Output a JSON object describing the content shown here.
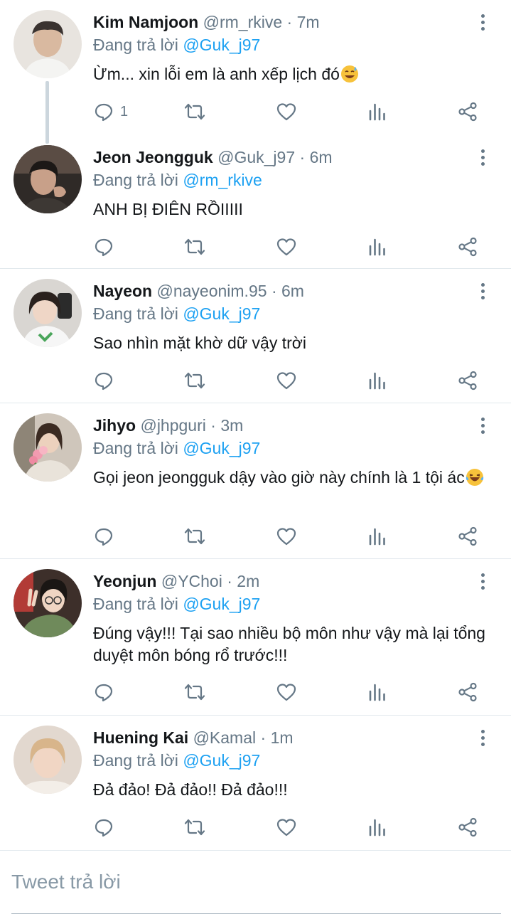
{
  "reply_prefix": "Đang trả lời",
  "tweets": [
    {
      "name": "Kim Namjoon",
      "handle": "@rm_rkive",
      "dot": "·",
      "time": "7m",
      "reply_to": "@Guk_j97",
      "text": "Ừm... xin lỗi em là anh xếp lịch đó",
      "emoji": "sweat-smile-emoji",
      "reply_count": "1",
      "avatar": "avatar-kim-namjoon"
    },
    {
      "name": "Jeon Jeongguk",
      "handle": "@Guk_j97",
      "dot": "·",
      "time": "6m",
      "reply_to": "@rm_rkive",
      "text": "ANH BỊ ĐIÊN RỒIIIII",
      "reply_count": "",
      "avatar": "avatar-jeon-jeongguk"
    },
    {
      "name": "Nayeon",
      "handle": "@nayeonim.95",
      "dot": "·",
      "time": "6m",
      "reply_to": "@Guk_j97",
      "text": "Sao nhìn mặt khờ dữ vậy trời",
      "reply_count": "",
      "avatar": "avatar-nayeon"
    },
    {
      "name": "Jihyo",
      "handle": "@jhpguri",
      "dot": "·",
      "time": "3m",
      "reply_to": "@Guk_j97",
      "text": "Gọi jeon jeongguk dậy vào giờ này chính là 1 tội ác",
      "emoji": "laughing-tears-emoji",
      "reply_count": "",
      "avatar": "avatar-jihyo"
    },
    {
      "name": "Yeonjun",
      "handle": "@YChoi",
      "dot": "·",
      "time": "2m",
      "reply_to": "@Guk_j97",
      "text": "Đúng vậy!!! Tại sao nhiều bộ môn như vậy mà lại tổng duyệt môn bóng rổ trước!!!",
      "reply_count": "",
      "avatar": "avatar-yeonjun"
    },
    {
      "name": "Huening Kai",
      "handle": "@Kamal",
      "dot": "·",
      "time": "1m",
      "reply_to": "@Guk_j97",
      "text": "Đả đảo! Đả đảo!! Đả đảo!!!",
      "reply_count": "",
      "avatar": "avatar-huening-kai"
    }
  ],
  "compose": {
    "placeholder": "Tweet trả lời"
  },
  "colors": {
    "link": "#1da1f2",
    "secondary_text": "#657786",
    "divider": "#e1e8ed"
  }
}
